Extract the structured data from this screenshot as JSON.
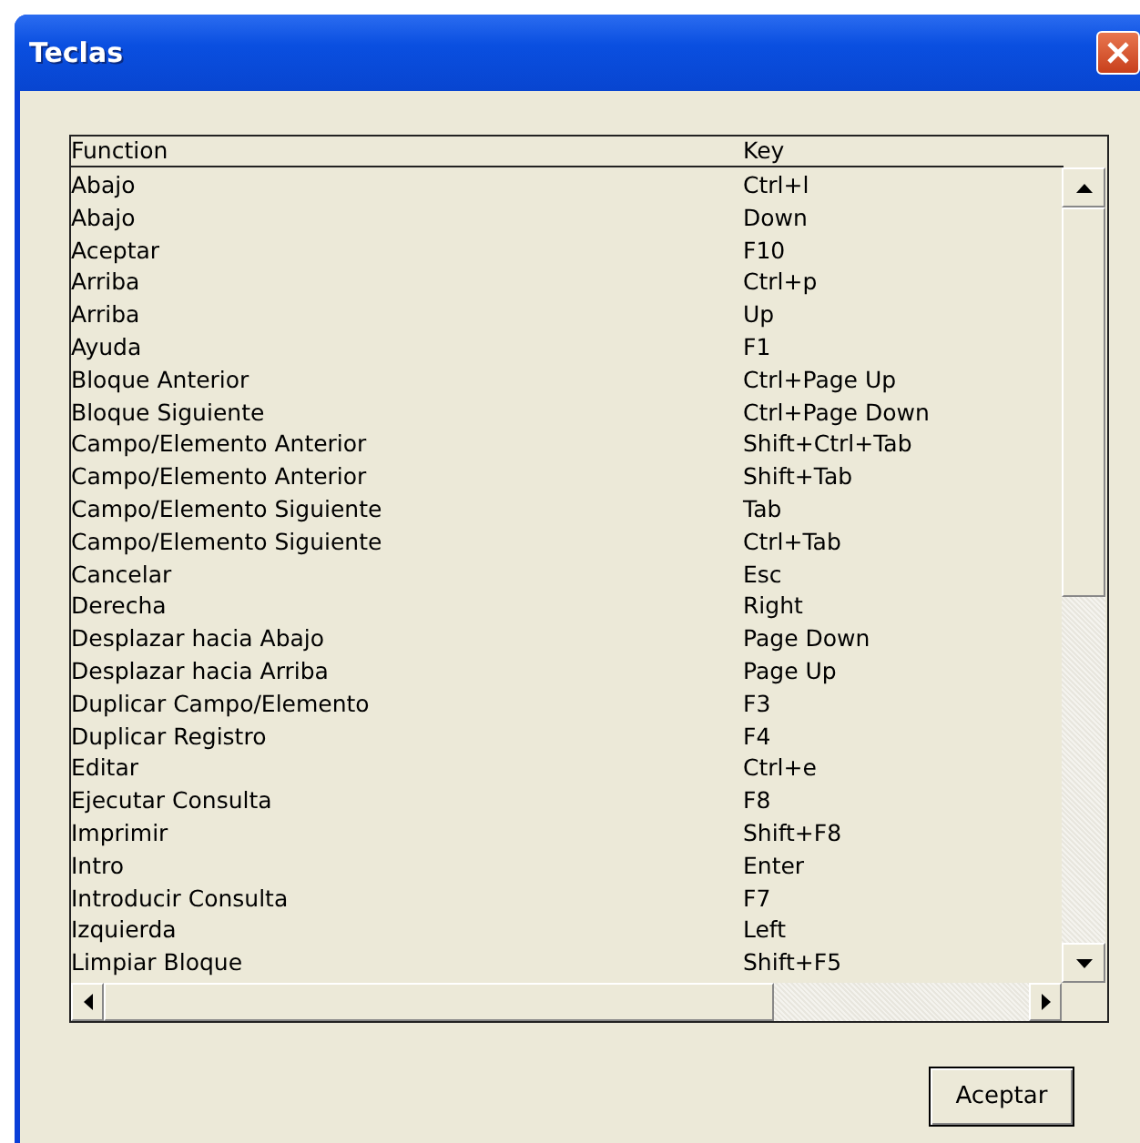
{
  "window": {
    "title": "Teclas"
  },
  "table": {
    "columns": [
      "Function",
      "Key"
    ],
    "rows": [
      [
        "Abajo",
        "Ctrl+l"
      ],
      [
        "Abajo",
        "Down"
      ],
      [
        "Aceptar",
        "F10"
      ],
      [
        "Arriba",
        "Ctrl+p"
      ],
      [
        "Arriba",
        "Up"
      ],
      [
        "Ayuda",
        "F1"
      ],
      [
        "Bloque Anterior",
        "Ctrl+Page Up"
      ],
      [
        "Bloque Siguiente",
        "Ctrl+Page Down"
      ],
      [
        "Campo/Elemento Anterior",
        "Shift+Ctrl+Tab"
      ],
      [
        "Campo/Elemento Anterior",
        "Shift+Tab"
      ],
      [
        "Campo/Elemento Siguiente",
        "Tab"
      ],
      [
        "Campo/Elemento Siguiente",
        "Ctrl+Tab"
      ],
      [
        "Cancelar",
        "Esc"
      ],
      [
        "Derecha",
        "Right"
      ],
      [
        "Desplazar hacia Abajo",
        "Page Down"
      ],
      [
        "Desplazar hacia Arriba",
        "Page Up"
      ],
      [
        "Duplicar Campo/Elemento",
        "F3"
      ],
      [
        "Duplicar Registro",
        "F4"
      ],
      [
        "Editar",
        "Ctrl+e"
      ],
      [
        "Ejecutar Consulta",
        "F8"
      ],
      [
        "Imprimir",
        "Shift+F8"
      ],
      [
        "Intro",
        "Enter"
      ],
      [
        "Introducir Consulta",
        "F7"
      ],
      [
        "Izquierda",
        "Left"
      ],
      [
        "Limpiar Bloque",
        "Shift+F5"
      ]
    ]
  },
  "buttons": [
    "Aceptar"
  ]
}
